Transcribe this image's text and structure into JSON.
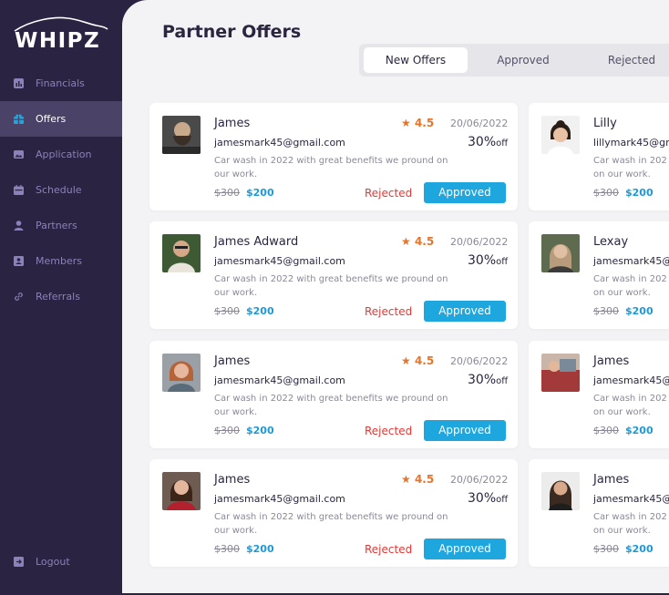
{
  "app": {
    "logo_text": "WHIPZ"
  },
  "sidebar": {
    "items": [
      {
        "label": "Financials",
        "icon": "chart-icon",
        "active": false
      },
      {
        "label": "Offers",
        "icon": "gift-icon",
        "active": true
      },
      {
        "label": "Application",
        "icon": "image-icon",
        "active": false
      },
      {
        "label": "Schedule",
        "icon": "calendar-icon",
        "active": false
      },
      {
        "label": "Partners",
        "icon": "person-icon",
        "active": false
      },
      {
        "label": "Members",
        "icon": "id-card-icon",
        "active": false
      },
      {
        "label": "Referrals",
        "icon": "link-icon",
        "active": false
      }
    ],
    "logout_label": "Logout"
  },
  "main": {
    "title": "Partner Offers",
    "tabs": [
      {
        "label": "New Offers",
        "active": true
      },
      {
        "label": "Approved",
        "active": false
      },
      {
        "label": "Rejected",
        "active": false
      }
    ]
  },
  "offers_left": [
    {
      "name": "James",
      "email": "jamesmark45@gmail.com",
      "rating": "4.5",
      "date": "20/06/2022",
      "discount": "30%",
      "discount_suffix": "off",
      "description": "Car wash in 2022 with great benefits we pround on our work.",
      "price_old": "$300",
      "price_new": "$200",
      "reject_label": "Rejected",
      "approve_label": "Approved"
    },
    {
      "name": "James Adward",
      "email": "jamesmark45@gmail.com",
      "rating": "4.5",
      "date": "20/06/2022",
      "discount": "30%",
      "discount_suffix": "off",
      "description": "Car wash in 2022 with great benefits we pround on our work.",
      "price_old": "$300",
      "price_new": "$200",
      "reject_label": "Rejected",
      "approve_label": "Approved"
    },
    {
      "name": "James",
      "email": "jamesmark45@gmail.com",
      "rating": "4.5",
      "date": "20/06/2022",
      "discount": "30%",
      "discount_suffix": "off",
      "description": "Car wash in 2022 with great benefits we pround on our work.",
      "price_old": "$300",
      "price_new": "$200",
      "reject_label": "Rejected",
      "approve_label": "Approved"
    },
    {
      "name": "James",
      "email": "jamesmark45@gmail.com",
      "rating": "4.5",
      "date": "20/06/2022",
      "discount": "30%",
      "discount_suffix": "off",
      "description": "Car wash in 2022 with great benefits we pround on our work.",
      "price_old": "$300",
      "price_new": "$200",
      "reject_label": "Rejected",
      "approve_label": "Approved"
    }
  ],
  "offers_right": [
    {
      "name": "Lilly",
      "email": "lillymark45@gm",
      "description_line1": "Car wash in 202",
      "description_line2": "on our work.",
      "price_old": "$300",
      "price_new": "$200"
    },
    {
      "name": "Lexay",
      "email": "jamesmark45@g",
      "description_line1": "Car wash in 202",
      "description_line2": "on our work.",
      "price_old": "$300",
      "price_new": "$200"
    },
    {
      "name": "James",
      "email": "jamesmark45@",
      "description_line1": "Car wash in 202",
      "description_line2": "on our work.",
      "price_old": "$300",
      "price_new": "$200"
    },
    {
      "name": "James",
      "email": "jamesmark45@",
      "description_line1": "Car wash in 202",
      "description_line2": "on our work.",
      "price_old": "$300",
      "price_new": "$200"
    }
  ],
  "colors": {
    "sidebar_bg": "#2b2342",
    "accent_blue": "#1ea6de",
    "reject_red": "#e53935",
    "star_orange": "#e8742a"
  }
}
